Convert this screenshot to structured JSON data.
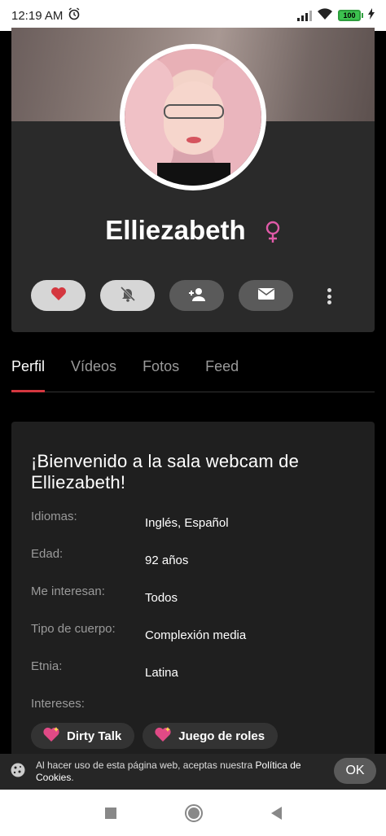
{
  "status_bar": {
    "time": "12:19 AM",
    "battery": "100",
    "icons": [
      "alarm-icon",
      "signal-icon",
      "wifi-icon",
      "battery-icon",
      "charging-icon"
    ]
  },
  "profile": {
    "name": "Elliezabeth",
    "gender_icon": "female-icon",
    "gender_color": "#e05aa8",
    "actions": [
      {
        "name": "favorite",
        "icon": "heart-icon",
        "style": "light"
      },
      {
        "name": "notifications",
        "icon": "bell-off-icon",
        "style": "light"
      },
      {
        "name": "follow",
        "icon": "add-user-icon",
        "style": "dark"
      },
      {
        "name": "message",
        "icon": "mail-icon",
        "style": "dark"
      }
    ],
    "more_icon": "more-vertical-icon"
  },
  "tabs": {
    "items": [
      {
        "label": "Perfil",
        "active": true
      },
      {
        "label": "Vídeos",
        "active": false
      },
      {
        "label": "Fotos",
        "active": false
      },
      {
        "label": "Feed",
        "active": false
      }
    ],
    "accent": "#d4373f"
  },
  "info": {
    "welcome": "¡Bienvenido a la sala webcam de Elliezabeth!",
    "rows": [
      {
        "label": "Idiomas:",
        "value": "Inglés, Español"
      },
      {
        "label": "Edad:",
        "value": "92 años"
      },
      {
        "label": "Me interesan:",
        "value": "Todos"
      },
      {
        "label": "Tipo de cuerpo:",
        "value": "Complexión media"
      },
      {
        "label": "Etnia:",
        "value": "Latina"
      },
      {
        "label": "Intereses:",
        "value": ""
      }
    ],
    "interests": [
      {
        "label": "Dirty Talk",
        "icon": "sparkle-heart-icon"
      },
      {
        "label": "Juego de roles",
        "icon": "sparkle-heart-icon"
      }
    ]
  },
  "cookie": {
    "text": "Al hacer uso de esta página web, aceptas nuestra ",
    "link": "Política de Cookies",
    "period": ".",
    "ok": "OK",
    "icon": "cookie-icon"
  },
  "nav": {
    "icons": [
      "recents-icon",
      "home-icon",
      "back-icon"
    ]
  }
}
